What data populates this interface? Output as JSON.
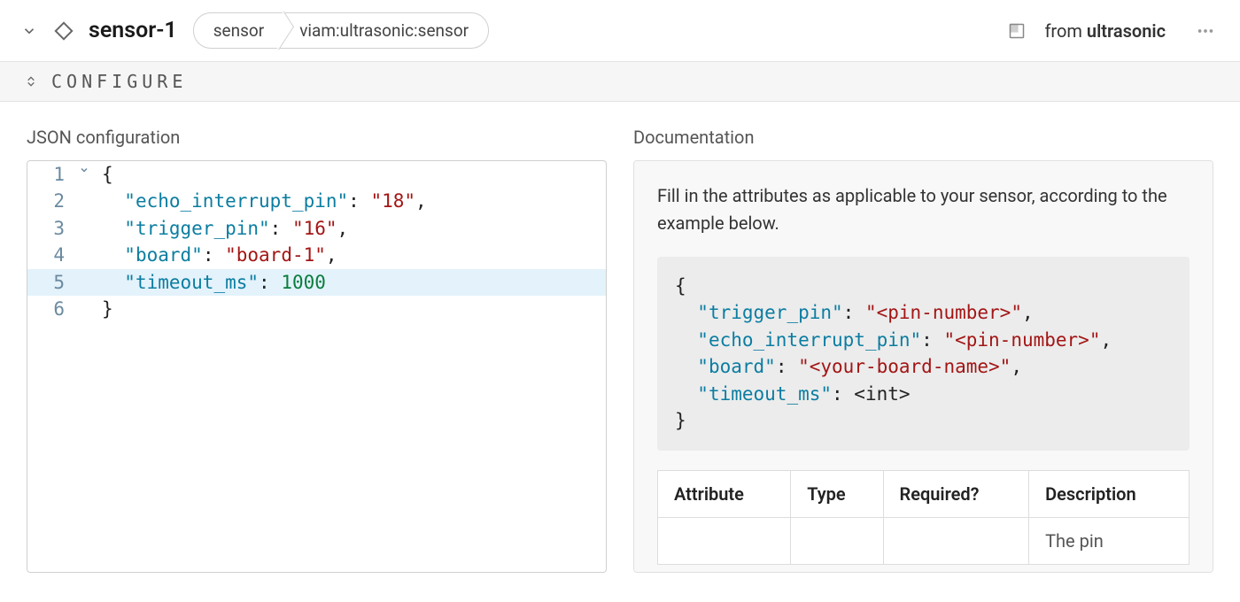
{
  "header": {
    "title": "sensor-1",
    "crumb1": "sensor",
    "crumb2": "viam:ultrasonic:sensor",
    "from_prefix": "from ",
    "from_module": "ultrasonic"
  },
  "section": {
    "label": "CONFIGURE"
  },
  "left": {
    "title": "JSON configuration",
    "lines": [
      {
        "n": "1",
        "fold": true,
        "hl": false,
        "tokens": [
          [
            "punc",
            "{"
          ]
        ]
      },
      {
        "n": "2",
        "fold": false,
        "hl": false,
        "tokens": [
          [
            "indent",
            "  "
          ],
          [
            "key",
            "\"echo_interrupt_pin\""
          ],
          [
            "punc",
            ": "
          ],
          [
            "str",
            "\"18\""
          ],
          [
            "punc",
            ","
          ]
        ]
      },
      {
        "n": "3",
        "fold": false,
        "hl": false,
        "tokens": [
          [
            "indent",
            "  "
          ],
          [
            "key",
            "\"trigger_pin\""
          ],
          [
            "punc",
            ": "
          ],
          [
            "str",
            "\"16\""
          ],
          [
            "punc",
            ","
          ]
        ]
      },
      {
        "n": "4",
        "fold": false,
        "hl": false,
        "tokens": [
          [
            "indent",
            "  "
          ],
          [
            "key",
            "\"board\""
          ],
          [
            "punc",
            ": "
          ],
          [
            "str",
            "\"board-1\""
          ],
          [
            "punc",
            ","
          ]
        ]
      },
      {
        "n": "5",
        "fold": false,
        "hl": true,
        "tokens": [
          [
            "indent",
            "  "
          ],
          [
            "key",
            "\"timeout_ms\""
          ],
          [
            "punc",
            ": "
          ],
          [
            "num",
            "1000"
          ]
        ]
      },
      {
        "n": "6",
        "fold": false,
        "hl": false,
        "tokens": [
          [
            "punc",
            "}"
          ]
        ]
      }
    ]
  },
  "right": {
    "title": "Documentation",
    "intro": "Fill in the attributes as applicable to your sensor, according to the example below.",
    "code_tokens": [
      [
        "punc",
        "{\n  "
      ],
      [
        "key",
        "\"trigger_pin\""
      ],
      [
        "punc",
        ": "
      ],
      [
        "str",
        "\"<pin-number>\""
      ],
      [
        "punc",
        ",\n  "
      ],
      [
        "key",
        "\"echo_interrupt_pin\""
      ],
      [
        "punc",
        ": "
      ],
      [
        "str",
        "\"<pin-number>\""
      ],
      [
        "punc",
        ",\n  "
      ],
      [
        "key",
        "\"board\""
      ],
      [
        "punc",
        ": "
      ],
      [
        "str",
        "\"<your-board-name>\""
      ],
      [
        "punc",
        ",\n  "
      ],
      [
        "key",
        "\"timeout_ms\""
      ],
      [
        "punc",
        ": <int>\n}"
      ]
    ],
    "table": {
      "headers": [
        "Attribute",
        "Type",
        "Required?",
        "Description"
      ],
      "partial_row": [
        "",
        "",
        "",
        "The pin"
      ]
    }
  }
}
